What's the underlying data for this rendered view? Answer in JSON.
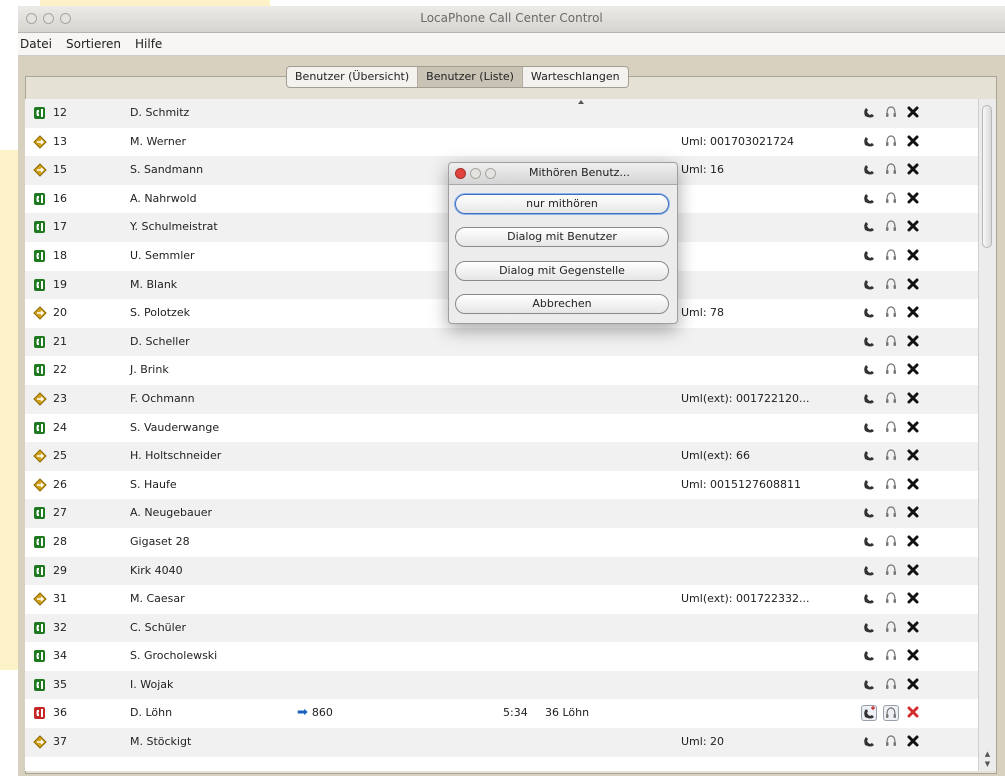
{
  "window": {
    "title": "LocaPhone Call Center Control",
    "menu": [
      "Datei",
      "Sortieren",
      "Hilfe"
    ]
  },
  "tabs": [
    {
      "label": "Benutzer (Übersicht)",
      "active": false
    },
    {
      "label": "Benutzer (Liste)",
      "active": true
    },
    {
      "label": "Warteschlangen",
      "active": false
    }
  ],
  "status_colors": {
    "available": "#1f7a1f",
    "forwarded": "#d4a017",
    "busy": "#c62828"
  },
  "action_icons": [
    "handset-icon",
    "listen-icon",
    "delete-icon"
  ],
  "rows": [
    {
      "status": "available",
      "num": "12",
      "name": "D. Schmitz",
      "forward": "",
      "time": "",
      "info": "",
      "extra": ""
    },
    {
      "status": "forwarded",
      "num": "13",
      "name": "M. Werner",
      "forward": "",
      "time": "",
      "info": "",
      "extra": "Uml: 001703021724"
    },
    {
      "status": "forwarded",
      "num": "15",
      "name": "S. Sandmann",
      "forward": "",
      "time": "",
      "info": "",
      "extra": "Uml: 16"
    },
    {
      "status": "available",
      "num": "16",
      "name": "A. Nahrwold",
      "forward": "",
      "time": "",
      "info": "",
      "extra": ""
    },
    {
      "status": "available",
      "num": "17",
      "name": "Y. Schulmeistrat",
      "forward": "",
      "time": "",
      "info": "",
      "extra": ""
    },
    {
      "status": "available",
      "num": "18",
      "name": "U. Semmler",
      "forward": "",
      "time": "",
      "info": "",
      "extra": ""
    },
    {
      "status": "available",
      "num": "19",
      "name": "M. Blank",
      "forward": "",
      "time": "",
      "info": "",
      "extra": ""
    },
    {
      "status": "forwarded",
      "num": "20",
      "name": "S. Polotzek",
      "forward": "",
      "time": "",
      "info": "",
      "extra": "Uml: 78"
    },
    {
      "status": "available",
      "num": "21",
      "name": "D. Scheller",
      "forward": "",
      "time": "",
      "info": "",
      "extra": ""
    },
    {
      "status": "available",
      "num": "22",
      "name": "J. Brink",
      "forward": "",
      "time": "",
      "info": "",
      "extra": ""
    },
    {
      "status": "forwarded",
      "num": "23",
      "name": "F. Ochmann",
      "forward": "",
      "time": "",
      "info": "",
      "extra": "Uml(ext): 001722120..."
    },
    {
      "status": "available",
      "num": "24",
      "name": "S. Vauderwange",
      "forward": "",
      "time": "",
      "info": "",
      "extra": ""
    },
    {
      "status": "forwarded",
      "num": "25",
      "name": "H. Holtschneider",
      "forward": "",
      "time": "",
      "info": "",
      "extra": "Uml(ext): 66"
    },
    {
      "status": "forwarded",
      "num": "26",
      "name": "S. Haufe",
      "forward": "",
      "time": "",
      "info": "",
      "extra": "Uml: 0015127608811"
    },
    {
      "status": "available",
      "num": "27",
      "name": "A. Neugebauer",
      "forward": "",
      "time": "",
      "info": "",
      "extra": ""
    },
    {
      "status": "available",
      "num": "28",
      "name": "Gigaset 28",
      "forward": "",
      "time": "",
      "info": "",
      "extra": ""
    },
    {
      "status": "available",
      "num": "29",
      "name": "Kirk 4040",
      "forward": "",
      "time": "",
      "info": "",
      "extra": ""
    },
    {
      "status": "forwarded",
      "num": "31",
      "name": "M. Caesar",
      "forward": "",
      "time": "",
      "info": "",
      "extra": "Uml(ext): 001722332..."
    },
    {
      "status": "available",
      "num": "32",
      "name": "C. Schüler",
      "forward": "",
      "time": "",
      "info": "",
      "extra": ""
    },
    {
      "status": "available",
      "num": "34",
      "name": "S. Grocholewski",
      "forward": "",
      "time": "",
      "info": "",
      "extra": ""
    },
    {
      "status": "available",
      "num": "35",
      "name": "I. Wojak",
      "forward": "",
      "time": "",
      "info": "",
      "extra": ""
    },
    {
      "status": "busy",
      "num": "36",
      "name": "D. Löhn",
      "forward": "860",
      "time": "5:34",
      "info": "36 Löhn",
      "extra": "",
      "highlight": true
    },
    {
      "status": "forwarded",
      "num": "37",
      "name": "M. Stöckigt",
      "forward": "",
      "time": "",
      "info": "",
      "extra": "Uml: 20"
    }
  ],
  "dialog": {
    "title": "Mithören Benutz...",
    "buttons": [
      "nur mithören",
      "Dialog mit Benutzer",
      "Dialog mit Gegenstelle",
      "Abbrechen"
    ]
  }
}
